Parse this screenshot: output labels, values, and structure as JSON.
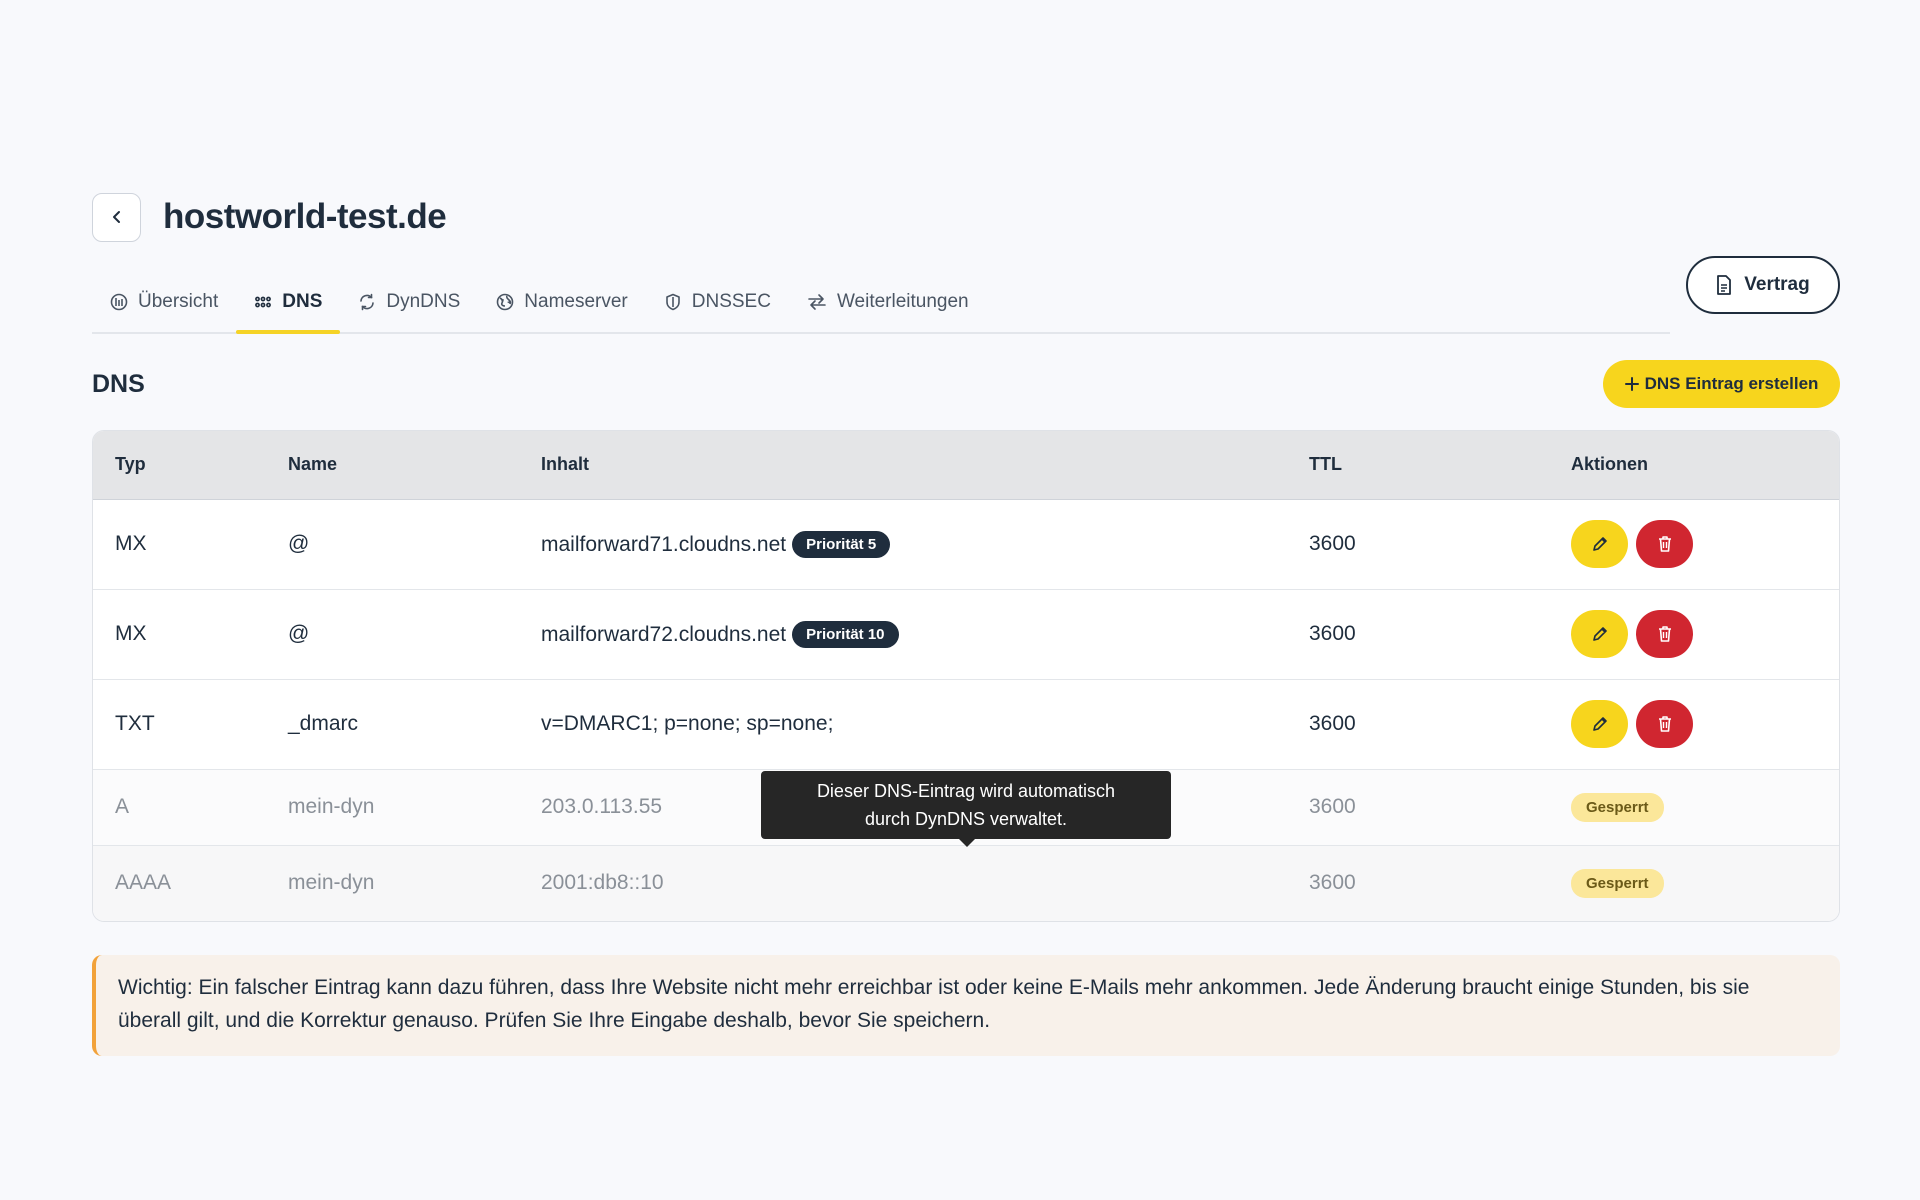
{
  "header": {
    "title": "hostworld-test.de"
  },
  "tabs": [
    {
      "label": "Übersicht",
      "icon": "overview-icon",
      "active": false
    },
    {
      "label": "DNS",
      "icon": "grid-icon",
      "active": true
    },
    {
      "label": "DynDNS",
      "icon": "refresh-icon",
      "active": false
    },
    {
      "label": "Nameserver",
      "icon": "globe-icon",
      "active": false
    },
    {
      "label": "DNSSEC",
      "icon": "shield-icon",
      "active": false
    },
    {
      "label": "Weiterleitungen",
      "icon": "arrows-icon",
      "active": false
    }
  ],
  "contract_button": {
    "label": "Vertrag"
  },
  "section": {
    "title": "DNS",
    "create_label": "DNS Eintrag erstellen"
  },
  "table": {
    "columns": [
      "Typ",
      "Name",
      "Inhalt",
      "TTL",
      "Aktionen"
    ],
    "rows": [
      {
        "type": "MX",
        "name": "@",
        "content": "mailforward71.cloudns.net",
        "badge": "Priorität 5",
        "ttl": "3600"
      },
      {
        "type": "MX",
        "name": "@",
        "content": "mailforward72.cloudns.net",
        "badge": "Priorität 10",
        "ttl": "3600"
      },
      {
        "type": "TXT",
        "name": "_dmarc",
        "content": "v=DMARC1; p=none; sp=none;",
        "ttl": "3600"
      },
      {
        "type": "A",
        "name": "mein-dyn",
        "content": "203.0.113.55",
        "ttl": "3600",
        "status": "Gesperrt"
      },
      {
        "type": "AAAA",
        "name": "mein-dyn",
        "content": "2001:db8::10",
        "ttl": "3600",
        "status": "Gesperrt"
      }
    ]
  },
  "tooltip": {
    "line1": "Dieser DNS-Eintrag wird automatisch",
    "line2": "durch DynDNS verwaltet."
  },
  "warning": {
    "text": "Wichtig: Ein falscher Eintrag kann dazu führen, dass Ihre Website nicht mehr erreichbar ist oder keine E-Mails mehr ankommen. Jede Änderung braucht einige Stunden, bis sie überall gilt, und die Korrektur genauso. Prüfen Sie Ihre Eingabe deshalb, bevor Sie speichern."
  },
  "colors": {
    "accent": "#f7d51d",
    "danger": "#d02630",
    "dark": "#1f2d3d",
    "warning_border": "#f2a23a"
  }
}
